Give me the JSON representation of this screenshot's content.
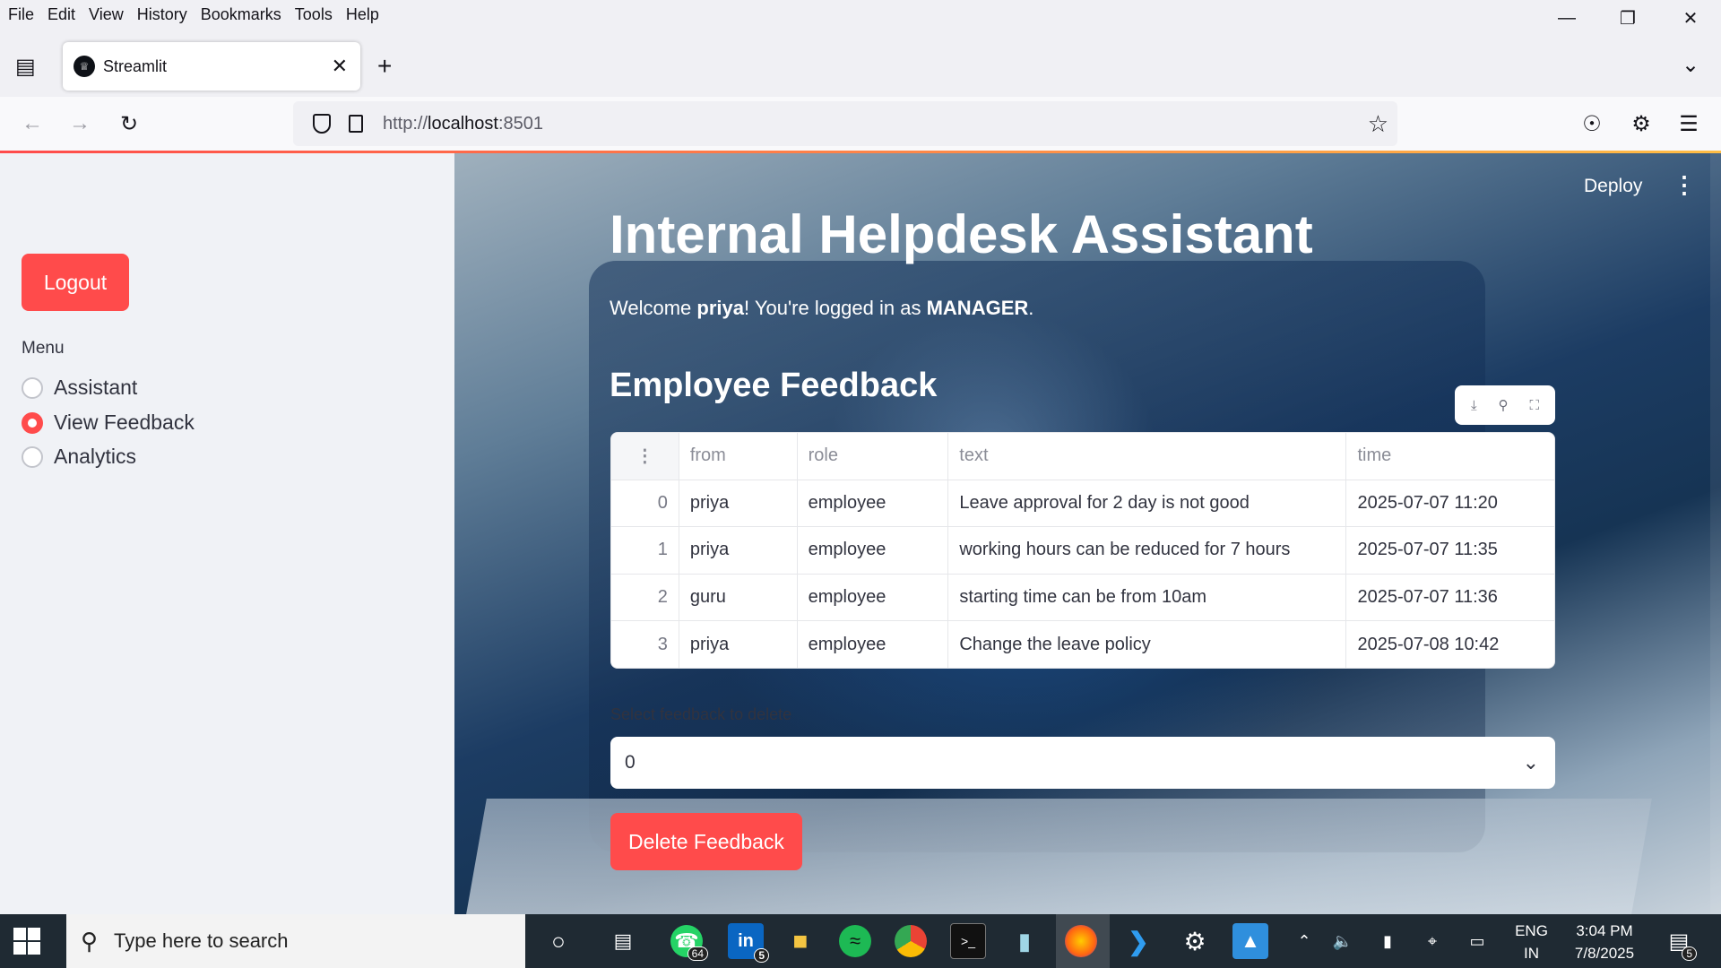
{
  "browser": {
    "menu": [
      "File",
      "Edit",
      "View",
      "History",
      "Bookmarks",
      "Tools",
      "Help"
    ],
    "tab_title": "Streamlit",
    "url_prefix": "http://",
    "url_host": "localhost",
    "url_suffix": ":8501"
  },
  "sidebar": {
    "logout_label": "Logout",
    "menu_label": "Menu",
    "options": [
      "Assistant",
      "View Feedback",
      "Analytics"
    ],
    "selected": "View Feedback"
  },
  "header": {
    "deploy_label": "Deploy"
  },
  "main": {
    "title": "Internal Helpdesk Assistant",
    "welcome_prefix": "Welcome ",
    "welcome_user": "priya",
    "welcome_mid": "! You're logged in as ",
    "welcome_role": "MANAGER",
    "welcome_end": ".",
    "section_title": "Employee Feedback",
    "table": {
      "columns": [
        "from",
        "role",
        "text",
        "time"
      ],
      "rows": [
        {
          "index": "0",
          "from": "priya",
          "role": "employee",
          "text": "Leave approval for 2 day is not good",
          "time": "2025-07-07 11:20"
        },
        {
          "index": "1",
          "from": "priya",
          "role": "employee",
          "text": "working hours can be reduced for 7 hours",
          "time": "2025-07-07 11:35"
        },
        {
          "index": "2",
          "from": "guru",
          "role": "employee",
          "text": "starting time can be from 10am",
          "time": "2025-07-07 11:36"
        },
        {
          "index": "3",
          "from": "priya",
          "role": "employee",
          "text": "Change the leave policy",
          "time": "2025-07-08 10:42"
        }
      ]
    },
    "select_label": "Select feedback to delete",
    "select_value": "0",
    "delete_label": "Delete Feedback"
  },
  "taskbar": {
    "search_placeholder": "Type here to search",
    "whatsapp_badge": "64",
    "linkedin_badge": "5",
    "lang_top": "ENG",
    "lang_bottom": "IN",
    "time": "3:04 PM",
    "date": "7/8/2025",
    "notification_count": "5"
  },
  "colors": {
    "accent": "#ff4b4b",
    "sidebar_bg": "#f0f2f6",
    "taskbar_bg": "#1f2a33"
  }
}
